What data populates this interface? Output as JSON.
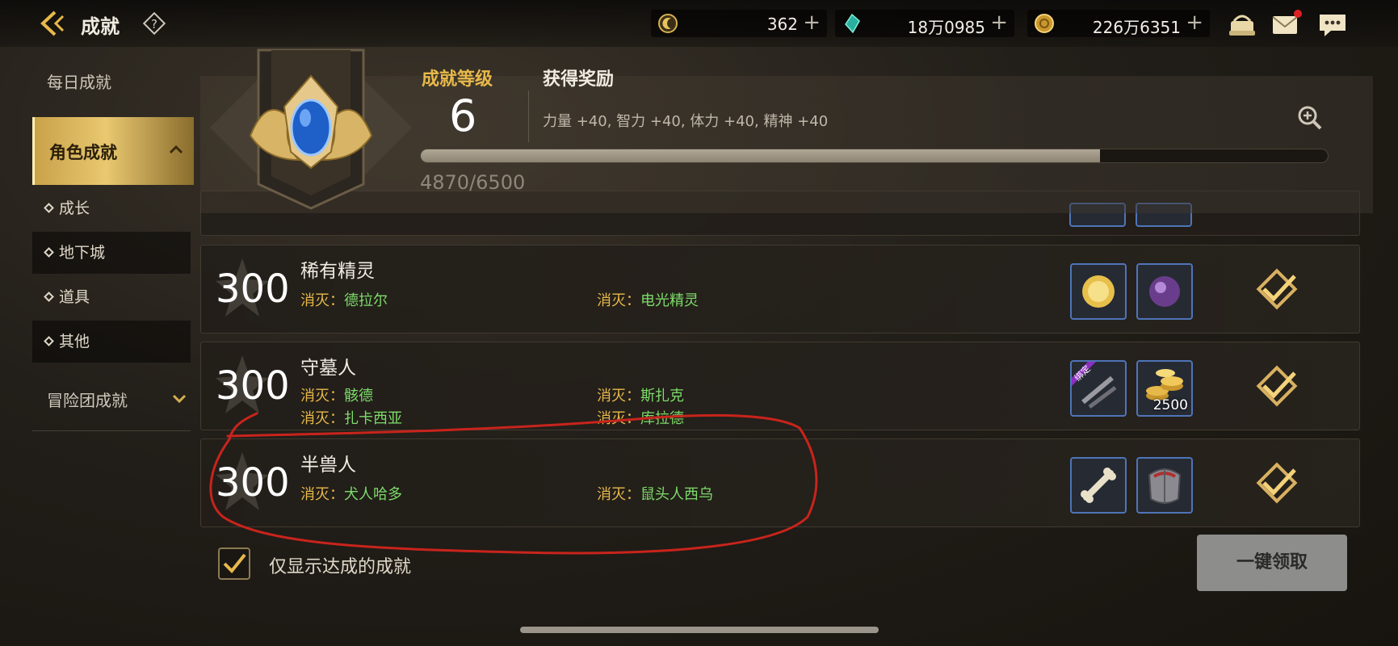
{
  "topbar": {
    "title": "成就",
    "currencies": [
      {
        "icon": "crescent-coin-icon",
        "value": "362",
        "plus": "+"
      },
      {
        "icon": "crystal-icon",
        "value": "18万0985",
        "plus": "+"
      },
      {
        "icon": "gold-coin-icon",
        "value": "226万6351",
        "plus": "+"
      }
    ],
    "icons": [
      "shop-icon",
      "mail-icon",
      "chat-icon"
    ],
    "mail_badge_color": "#e02020"
  },
  "sidebar": {
    "daily": "每日成就",
    "character": "角色成就",
    "subitems": [
      "成长",
      "地下城",
      "道具",
      "其他"
    ],
    "active_subitem": "地下城",
    "team": "冒险团成就"
  },
  "header": {
    "level_label": "成就等级",
    "level_value": "6",
    "reward_title": "获得奖励",
    "reward_desc": "力量 +40, 智力 +40, 体力 +40, 精神 +40",
    "progress_text": "4870/6500",
    "progress_fraction": 0.749
  },
  "rows": [
    {
      "points": "300",
      "name": "稀有精灵",
      "conditions": [
        {
          "key": "消灭：",
          "value": "德拉尔"
        },
        {
          "key": "消灭：",
          "value": "电光精灵"
        }
      ],
      "rewards": [
        "gold-orb-icon",
        "purple-orb-icon"
      ]
    },
    {
      "points": "300",
      "name": "守墓人",
      "conditions": [
        {
          "key": "消灭：",
          "value": "骸德"
        },
        {
          "key": "消灭：",
          "value": "斯扎克"
        },
        {
          "key": "消灭：",
          "value": "扎卡西亚"
        },
        {
          "key": "消灭：",
          "value": "库拉德"
        }
      ],
      "rewards": [
        "bound-item-icon",
        "gold-stack-icon"
      ],
      "reward_badge": "绑定",
      "reward_count": "2500"
    },
    {
      "points": "300",
      "name": "半兽人",
      "conditions": [
        {
          "key": "消灭：",
          "value": "犬人哈多"
        },
        {
          "key": "消灭：",
          "value": "鼠头人西乌"
        }
      ],
      "rewards": [
        "bone-icon",
        "armor-icon"
      ]
    }
  ],
  "bottom": {
    "checkbox_label": "仅显示达成的成就",
    "checkbox_checked": true,
    "claim_all": "一键领取"
  },
  "colors": {
    "accent_gold": "#e8b94a",
    "condition_green": "#7ddc6a",
    "annotation_red": "#c8241c"
  }
}
